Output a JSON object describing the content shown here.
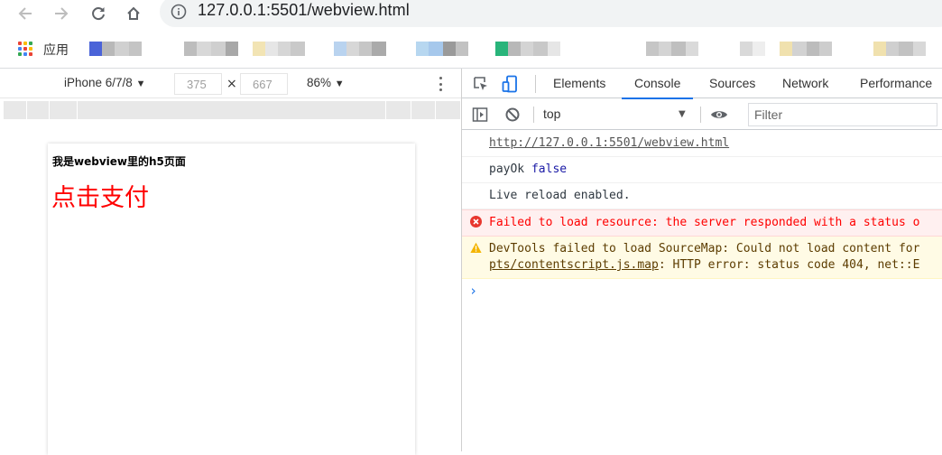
{
  "browser": {
    "url": "127.0.0.1:5501/webview.html",
    "bookmarks": {
      "apps_label": "应用"
    }
  },
  "device_toolbar": {
    "device": "iPhone 6/7/8",
    "width": "375",
    "height": "667",
    "zoom": "86%"
  },
  "page": {
    "heading": "我是webview里的h5页面",
    "pay_link": "点击支付"
  },
  "devtools": {
    "tabs": [
      {
        "label": "Elements",
        "active": false
      },
      {
        "label": "Console",
        "active": true
      },
      {
        "label": "Sources",
        "active": false
      },
      {
        "label": "Network",
        "active": false
      },
      {
        "label": "Performance",
        "active": false
      }
    ],
    "console_toolbar": {
      "context": "top",
      "filter_placeholder": "Filter"
    },
    "logs": [
      {
        "type": "log",
        "link": "http://127.0.0.1:5501/webview.html"
      },
      {
        "type": "log",
        "text": "payOk",
        "value": "false"
      },
      {
        "type": "log",
        "text": "Live reload enabled."
      },
      {
        "type": "error",
        "text": "Failed to load resource: the server responded with a status o"
      },
      {
        "type": "warn",
        "text": "DevTools failed to load SourceMap: Could not load content for",
        "link": "pts/contentscript.js.map",
        "text2": ": HTTP error: status code 404, net::E"
      }
    ]
  },
  "colors": {
    "accent": "#1a73e8",
    "error_text": "#ff0000",
    "error_bg": "#fff0f0",
    "warn_bg": "#fffbe5",
    "pay_link": "#ff0000"
  }
}
